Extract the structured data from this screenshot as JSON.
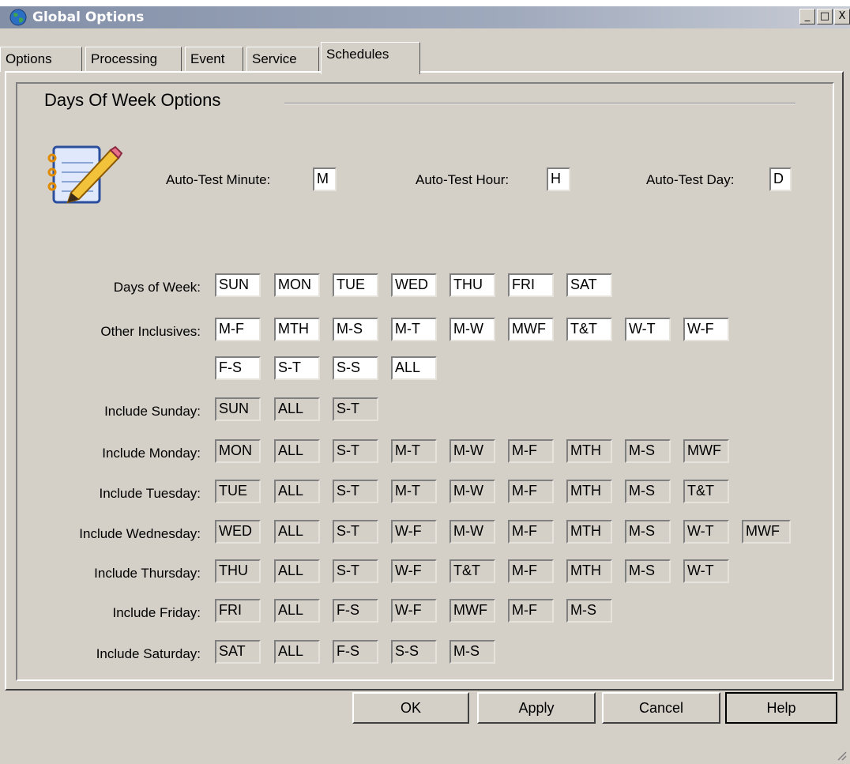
{
  "window": {
    "title": "Global Options",
    "minimize": "_",
    "maximize": "□",
    "close": "X"
  },
  "tabs": [
    "Options",
    "Processing",
    "Event",
    "Service",
    "Schedules"
  ],
  "active_tab": "Schedules",
  "section": {
    "title": "Days Of Week Options"
  },
  "auto_test": {
    "minute_label": "Auto-Test Minute:",
    "minute_value": "M",
    "hour_label": "Auto-Test Hour:",
    "hour_value": "H",
    "day_label": "Auto-Test Day:",
    "day_value": "D"
  },
  "rows": [
    {
      "label": "Days of Week:",
      "editable": true,
      "values": [
        "SUN",
        "MON",
        "TUE",
        "WED",
        "THU",
        "FRI",
        "SAT"
      ]
    },
    {
      "label": "Other Inclusives:",
      "editable": true,
      "values": [
        "M-F",
        "MTH",
        "M-S",
        "M-T",
        "M-W",
        "MWF",
        "T&T",
        "W-T",
        "W-F"
      ]
    },
    {
      "label": "",
      "editable": true,
      "values": [
        "F-S",
        "S-T",
        "S-S",
        "ALL"
      ]
    },
    {
      "label": "Include Sunday:",
      "editable": false,
      "values": [
        "SUN",
        "ALL",
        "S-T"
      ]
    },
    {
      "label": "Include Monday:",
      "editable": false,
      "values": [
        "MON",
        "ALL",
        "S-T",
        "M-T",
        "M-W",
        "M-F",
        "MTH",
        "M-S",
        "MWF"
      ]
    },
    {
      "label": "Include Tuesday:",
      "editable": false,
      "values": [
        "TUE",
        "ALL",
        "S-T",
        "M-T",
        "M-W",
        "M-F",
        "MTH",
        "M-S",
        "T&T"
      ]
    },
    {
      "label": "Include Wednesday:",
      "editable": false,
      "values": [
        "WED",
        "ALL",
        "S-T",
        "W-F",
        "M-W",
        "M-F",
        "MTH",
        "M-S",
        "W-T",
        "MWF"
      ]
    },
    {
      "label": "Include Thursday:",
      "editable": false,
      "values": [
        "THU",
        "ALL",
        "S-T",
        "W-F",
        "T&T",
        "M-F",
        "MTH",
        "M-S",
        "W-T"
      ]
    },
    {
      "label": "Include Friday:",
      "editable": false,
      "values": [
        "FRI",
        "ALL",
        "F-S",
        "W-F",
        "MWF",
        "M-F",
        "M-S"
      ]
    },
    {
      "label": "Include Saturday:",
      "editable": false,
      "values": [
        "SAT",
        "ALL",
        "F-S",
        "S-S",
        "M-S"
      ]
    }
  ],
  "buttons": {
    "ok": "OK",
    "apply": "Apply",
    "cancel": "Cancel",
    "help": "Help"
  },
  "colors": {
    "face": "#d4d0c8",
    "titlebar": "#828fa7",
    "field": "#ffffff"
  },
  "icons": {
    "app": "globe-icon",
    "notepad": "notepad-pencil-icon"
  }
}
